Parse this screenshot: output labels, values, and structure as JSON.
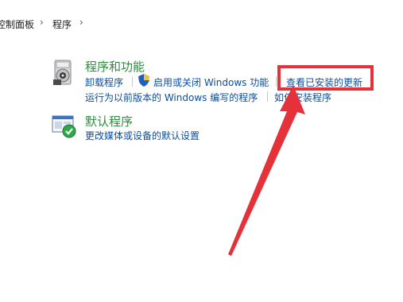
{
  "breadcrumb": {
    "items": [
      "控制面板",
      "程序"
    ],
    "separator": "›"
  },
  "programs_features": {
    "heading": "程序和功能",
    "links": {
      "uninstall": "卸载程序",
      "toggle_features": "启用或关闭 Windows 功能",
      "view_updates": "查看已安装的更新",
      "run_older": "运行为以前版本的 Windows 编写的程序",
      "how_to_install": "如何安装程序"
    },
    "icon": "programs-cd-icon",
    "shield_icon": "uac-shield-icon"
  },
  "default_programs": {
    "heading": "默认程序",
    "links": {
      "change_defaults": "更改媒体或设备的默认设置"
    },
    "icon": "default-programs-icon"
  },
  "annotation": {
    "box_color": "#e5323a",
    "arrow_color": "#e5323a"
  },
  "colors": {
    "link": "#0a4d9e",
    "heading": "#2d8a3e"
  }
}
